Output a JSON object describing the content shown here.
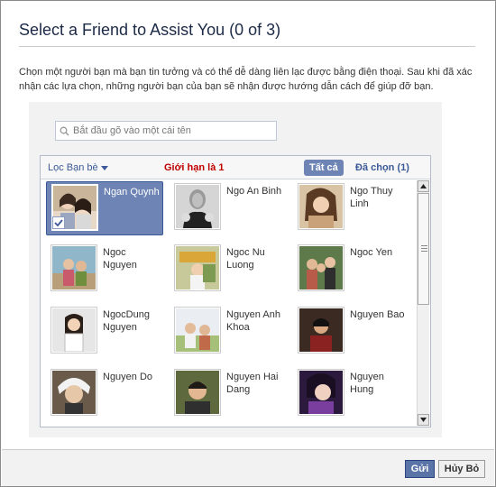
{
  "dialog": {
    "title": "Select a Friend to Assist You (0 of 3)",
    "description": "Chọn một người bạn mà bạn tin tưởng và có thể dễ dàng liên lạc được bằng điện thoại. Sau khi đã xác nhận các lựa chọn, những người bạn của bạn sẽ nhận được hướng dẫn cách để giúp đỡ bạn."
  },
  "search": {
    "placeholder": "Bắt đầu gõ vào một cái tên",
    "icon": "search-icon"
  },
  "toolbar": {
    "filter_label": "Lọc Bạn bè",
    "limit_text": "Giới hạn là 1",
    "tab_all": "Tất cả",
    "tab_selected": "Đã chọn (1)"
  },
  "friends": [
    {
      "name": "Ngan Quynh",
      "selected": true
    },
    {
      "name": "Ngo An Binh",
      "selected": false
    },
    {
      "name": "Ngo Thuy Linh",
      "selected": false
    },
    {
      "name": "Ngoc Nguyen",
      "selected": false
    },
    {
      "name": "Ngoc Nu Luong",
      "selected": false
    },
    {
      "name": "Ngoc Yen",
      "selected": false
    },
    {
      "name": "NgocDung Nguyen",
      "selected": false
    },
    {
      "name": "Nguyen Anh Khoa",
      "selected": false
    },
    {
      "name": "Nguyen Bao",
      "selected": false
    },
    {
      "name": "Nguyen Do",
      "selected": false
    },
    {
      "name": "Nguyen Hai Dang",
      "selected": false
    },
    {
      "name": "Nguyen Hung",
      "selected": false
    }
  ],
  "footer": {
    "send_label": "Gửi",
    "cancel_label": "Hủy Bỏ"
  },
  "colors": {
    "accent": "#3b5998",
    "selected_bg": "#6d84b4",
    "limit_red": "#c00000"
  }
}
